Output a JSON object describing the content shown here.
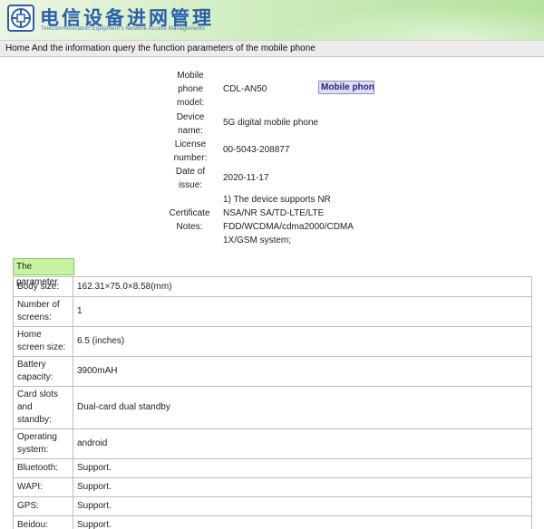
{
  "header": {
    "logo_icon": "telecom-network-logo",
    "title": "电信设备进网管理",
    "subtitle": "Telecommunication Equipment's Network Access Managements",
    "title_color": "#2a5fa8"
  },
  "nav": {
    "breadcrumb": "Home And the information query the function parameters of the mobile phone"
  },
  "info": {
    "model_label": "Mobile phone model:",
    "model_value": "CDL-AN50",
    "device_label": "Device name:",
    "device_value": "5G digital mobile phone",
    "license_label": "License number:",
    "license_value": "00-5043-208877",
    "date_label": "Date of issue:",
    "date_value": "2020-11-17",
    "notes_label": "Certificate Notes:",
    "notes_value": "1) The device supports NR NSA/NR SA/TD-LTE/LTE FDD/WCDMA/cdma2000/CDMA 1X/GSM system;",
    "badge": "Mobile phon"
  },
  "params": {
    "heading": "The parameter",
    "rows": [
      {
        "label": "Body size:",
        "value": "162.31×75.0×8.58(mm)"
      },
      {
        "label": "Number of screens:",
        "value": "1"
      },
      {
        "label": "Home screen size:",
        "value": "6.5 (inches)"
      },
      {
        "label": "Battery capacity:",
        "value": "3900mAH"
      },
      {
        "label": "Card slots and standby:",
        "value": "Dual-card dual standby"
      },
      {
        "label": "Operating system:",
        "value": "android"
      },
      {
        "label": "Bluetooth:",
        "value": "Support."
      },
      {
        "label": "WAPI:",
        "value": "Support."
      },
      {
        "label": "GPS:",
        "value": "Support."
      },
      {
        "label": "Beidou:",
        "value": "Support."
      }
    ]
  },
  "colors": {
    "header_green": "#c2e7ae",
    "parameter_heading_bg": "#c8f2a4",
    "badge_bg": "#dde0f4"
  }
}
